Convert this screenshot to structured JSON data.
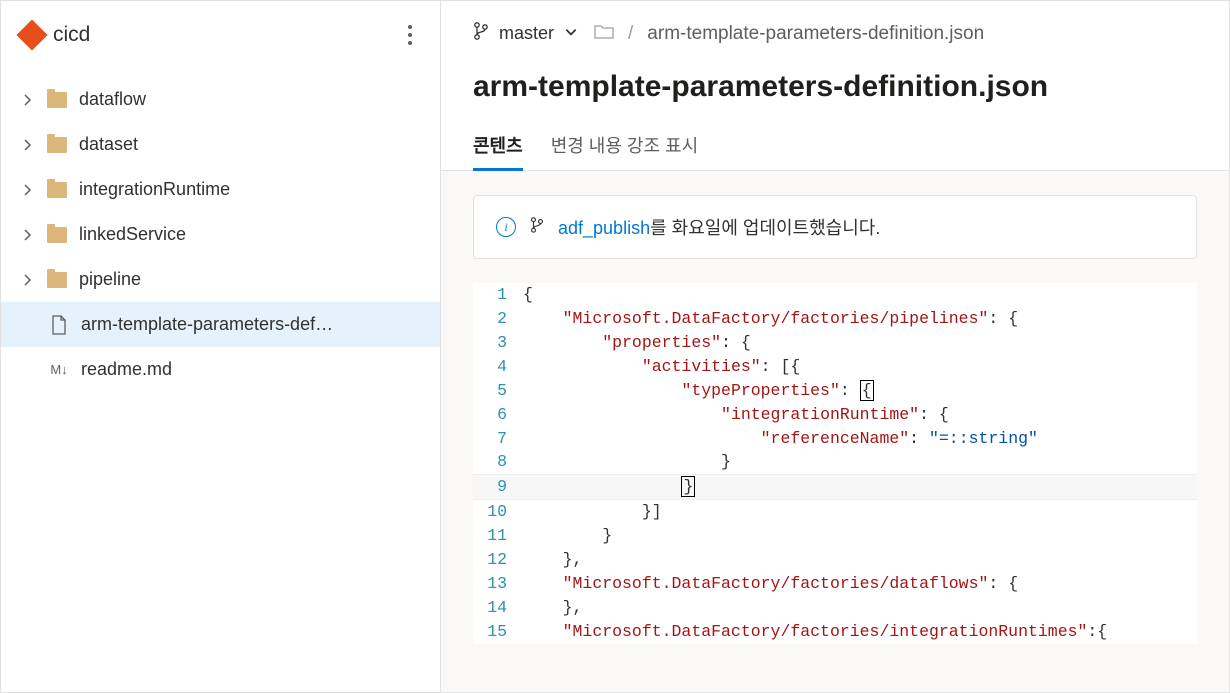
{
  "repo": {
    "name": "cicd"
  },
  "tree": {
    "folders": [
      {
        "label": "dataflow"
      },
      {
        "label": "dataset"
      },
      {
        "label": "integrationRuntime"
      },
      {
        "label": "linkedService"
      },
      {
        "label": "pipeline"
      }
    ],
    "files": [
      {
        "label": "arm-template-parameters-def…",
        "selected": true,
        "type": "file"
      },
      {
        "label": "readme.md",
        "selected": false,
        "type": "md"
      }
    ]
  },
  "branch": {
    "name": "master"
  },
  "breadcrumb": {
    "file": "arm-template-parameters-definition.json"
  },
  "title": "arm-template-parameters-definition.json",
  "tabs": {
    "contents": "콘텐츠",
    "highlight": "변경 내용 강조 표시"
  },
  "banner": {
    "link": "adf_publish",
    "text": "를 화요일에 업데이트했습니다."
  },
  "code": {
    "l1": "{",
    "l2a": "    ",
    "l2k": "\"Microsoft.DataFactory/factories/pipelines\"",
    "l2b": ": {",
    "l3a": "        ",
    "l3k": "\"properties\"",
    "l3b": ": {",
    "l4a": "            ",
    "l4k": "\"activities\"",
    "l4b": ": [{",
    "l5a": "                ",
    "l5k": "\"typeProperties\"",
    "l5b": ": ",
    "l6a": "                    ",
    "l6k": "\"integrationRuntime\"",
    "l6b": ": {",
    "l7a": "                        ",
    "l7k": "\"referenceName\"",
    "l7b": ": ",
    "l7v": "\"=::string\"",
    "l8": "                    }",
    "l9": "                ",
    "l10": "            }]",
    "l11": "        }",
    "l12": "    },",
    "l13a": "    ",
    "l13k": "\"Microsoft.DataFactory/factories/dataflows\"",
    "l13b": ": {",
    "l14": "    },",
    "l15a": "    ",
    "l15k": "\"Microsoft.DataFactory/factories/integrationRuntimes\"",
    "l15b": ":{",
    "n1": "1",
    "n2": "2",
    "n3": "3",
    "n4": "4",
    "n5": "5",
    "n6": "6",
    "n7": "7",
    "n8": "8",
    "n9": "9",
    "n10": "10",
    "n11": "11",
    "n12": "12",
    "n13": "13",
    "n14": "14",
    "n15": "15"
  }
}
